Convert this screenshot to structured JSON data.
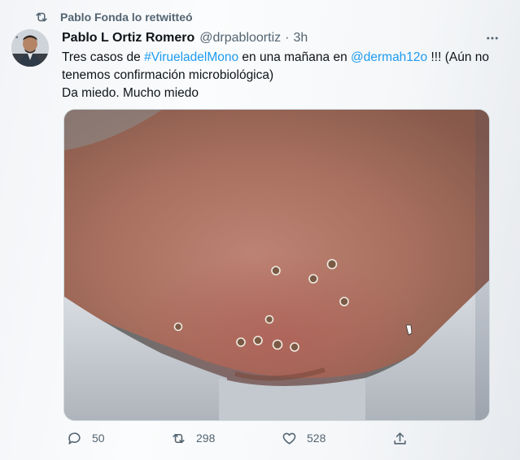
{
  "retweet_context": {
    "text": "Pablo Fonda lo retwitteó",
    "icon": "retweet-icon"
  },
  "tweet": {
    "author_name": "Pablo L Ortiz Romero",
    "handle": "@drpabloortiz",
    "separator": "·",
    "time": "3h",
    "more_icon": "more-horizontal-icon",
    "text": {
      "l1_prefix": "Tres casos de ",
      "hashtag": "#VirueladelMono",
      "l1_mid": " en una mañana en ",
      "mention": "@dermah12o",
      "l1_suffix": " !!! (Aún no tenemos confirmación microbiológica)",
      "line2": "Da miedo. Mucho miedo"
    },
    "link_color": "#1d9bf0"
  },
  "actions": {
    "reply": {
      "icon": "reply-icon",
      "count": "50"
    },
    "retweet": {
      "icon": "retweet-icon",
      "count": "298"
    },
    "like": {
      "icon": "heart-icon",
      "count": "528"
    },
    "share": {
      "icon": "share-icon"
    }
  }
}
